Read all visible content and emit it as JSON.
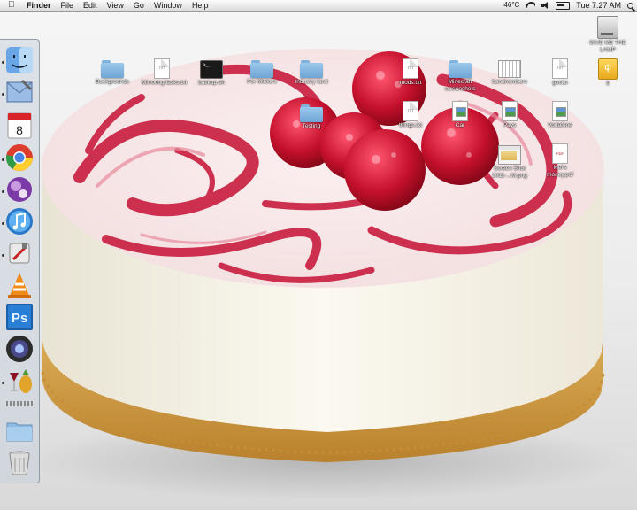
{
  "menubar": {
    "apple_icon": "apple-logo-icon",
    "app_name": "Finder",
    "menus": [
      "File",
      "Edit",
      "View",
      "Go",
      "Window",
      "Help"
    ],
    "temperature": "46°C",
    "clock": "Tue 7:27 AM",
    "status_icons": [
      "wifi-icon",
      "volume-icon",
      "battery-icon",
      "spotlight-icon"
    ]
  },
  "dock": {
    "apps": [
      {
        "name": "Finder",
        "icon": "finder-icon",
        "running": true
      },
      {
        "name": "Mail",
        "icon": "mail-icon",
        "running": true
      },
      {
        "name": "iCal",
        "icon": "calendar-icon",
        "running": false,
        "badge": "8"
      },
      {
        "name": "Google Chrome",
        "icon": "chrome-icon",
        "running": true
      },
      {
        "name": "Purple app",
        "icon": "purple-orb-icon",
        "running": true
      },
      {
        "name": "iTunes",
        "icon": "itunes-icon",
        "running": true
      },
      {
        "name": "Utility",
        "icon": "utility-icon",
        "running": true
      },
      {
        "name": "VLC",
        "icon": "vlc-icon",
        "running": false
      },
      {
        "name": "Photoshop",
        "icon": "photoshop-icon",
        "running": false,
        "label": "Ps"
      },
      {
        "name": "Aperture",
        "icon": "aperture-icon",
        "running": false
      },
      {
        "name": "Wine",
        "icon": "wine-pineapple-icon",
        "running": true
      },
      {
        "name": "Applications",
        "icon": "folder-icon",
        "running": false
      },
      {
        "name": "Trash",
        "icon": "trash-icon",
        "running": false
      }
    ]
  },
  "desktop": {
    "icons": [
      {
        "label": "Backgrounds",
        "kind": "folder"
      },
      {
        "label": "Mirroring tasks.txt",
        "kind": "text",
        "tag": "TXT"
      },
      {
        "label": "backup.sh",
        "kind": "terminal"
      },
      {
        "label": "For Mieke's",
        "kind": "folder"
      },
      {
        "label": "Industry land",
        "kind": "folder"
      },
      {
        "label": "mods.txt",
        "kind": "text",
        "tag": "TXT"
      },
      {
        "label": "Minecraft screenshots",
        "kind": "folder"
      },
      {
        "label": "bandnumbers",
        "kind": "sheet"
      },
      {
        "label": "gecko",
        "kind": "text",
        "tag": "TXT"
      },
      {
        "label": "Testing",
        "kind": "folder"
      },
      {
        "label": "things.txt",
        "kind": "text",
        "tag": "TXT"
      },
      {
        "label": "Car",
        "kind": "image"
      },
      {
        "label": "Pays",
        "kind": "image"
      },
      {
        "label": "Vodafone",
        "kind": "image"
      },
      {
        "label": "Screen Shot 2011-...M.png",
        "kind": "screenshot"
      },
      {
        "label": "Mel's money.pdf",
        "kind": "pdf"
      },
      {
        "label": "GIVE ME THE LAMP",
        "kind": "hdd"
      },
      {
        "label": "0",
        "kind": "usb"
      }
    ]
  }
}
